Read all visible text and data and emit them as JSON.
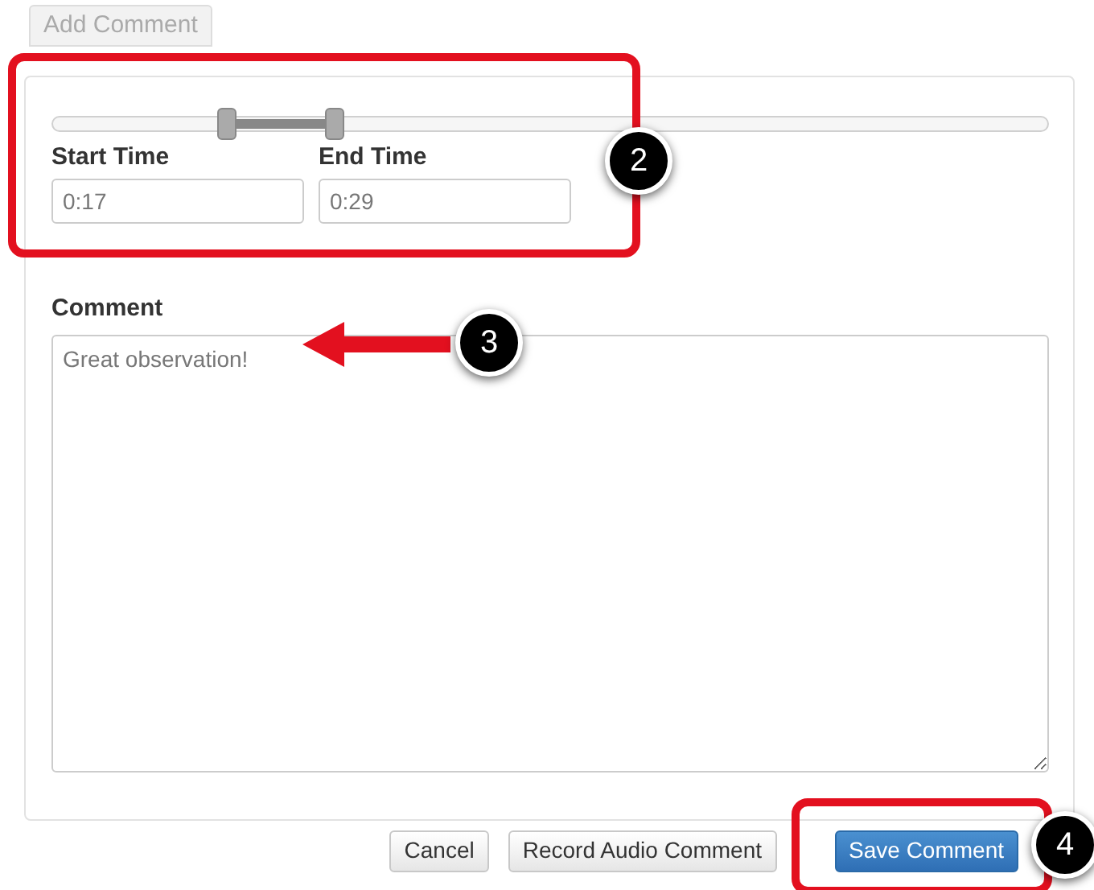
{
  "add_comment_button": {
    "label": "Add Comment",
    "disabled": true
  },
  "time_range": {
    "handles": [
      {
        "level": 0.17
      },
      {
        "level": 0.28
      }
    ]
  },
  "start_time": {
    "label": "Start Time",
    "value": "0:17"
  },
  "end_time": {
    "label": "End Time",
    "value": "0:29"
  },
  "comment": {
    "label": "Comment",
    "value": "Great observation!"
  },
  "buttons": [
    {
      "label": "Cancel",
      "kind": "default"
    },
    {
      "label": "Record Audio Comment",
      "kind": "default"
    },
    {
      "label": "Save Comment",
      "kind": "primary"
    }
  ],
  "callouts": [
    "2",
    "3",
    "4"
  ]
}
